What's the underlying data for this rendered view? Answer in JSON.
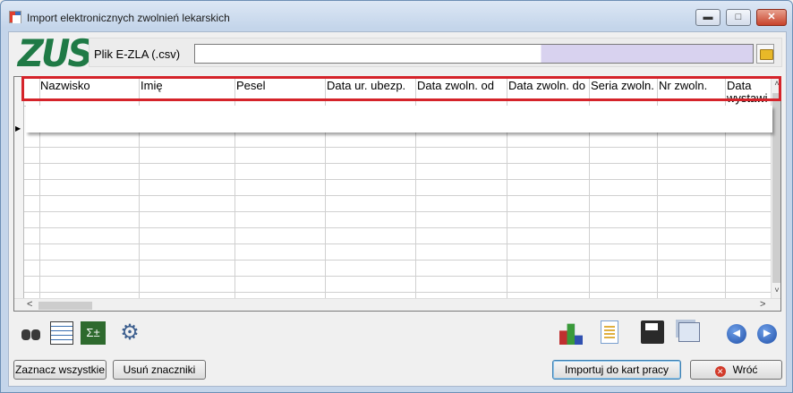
{
  "window": {
    "title": "Import elektronicznych zwolnień lekarskich",
    "min_glyph": "▬",
    "max_glyph": "□",
    "close_glyph": "✕"
  },
  "logo": {
    "text": "ZUS",
    "color": "#1f7a46"
  },
  "file": {
    "label": "Plik  E-ZLA (.csv)",
    "value": ""
  },
  "grid": {
    "columns": [
      "Nazwisko",
      "Imię",
      "Pesel",
      "Data ur. ubezp.",
      "Data zwoln. od",
      "Data zwoln. do",
      "Seria zwoln.",
      "Nr zwoln.",
      "Data wystawi"
    ],
    "rows": [],
    "current_row_glyph": "▶"
  },
  "scroll": {
    "up": "˄",
    "down": "˅",
    "left": "<",
    "right": ">"
  },
  "toolbar_left": [
    "binoculars-icon",
    "table-search-icon",
    "formula-icon",
    "gears-icon"
  ],
  "toolbar_right": [
    "chart-icon",
    "document-icon",
    "save-icon",
    "windows-icon",
    "prev-icon",
    "next-icon"
  ],
  "nav": {
    "prev": "◀",
    "next": "▶",
    "gears": "⚙",
    "sigma": "Σ±"
  },
  "buttons": {
    "select_all": "Zaznacz wszystkie",
    "unmark": "Usuń znaczniki",
    "import": "Importuj do kart pracy",
    "back": "Wróć",
    "back_glyph": "✕"
  },
  "colors": {
    "highlight": "#d5232a",
    "accent": "#3c7fb1"
  }
}
